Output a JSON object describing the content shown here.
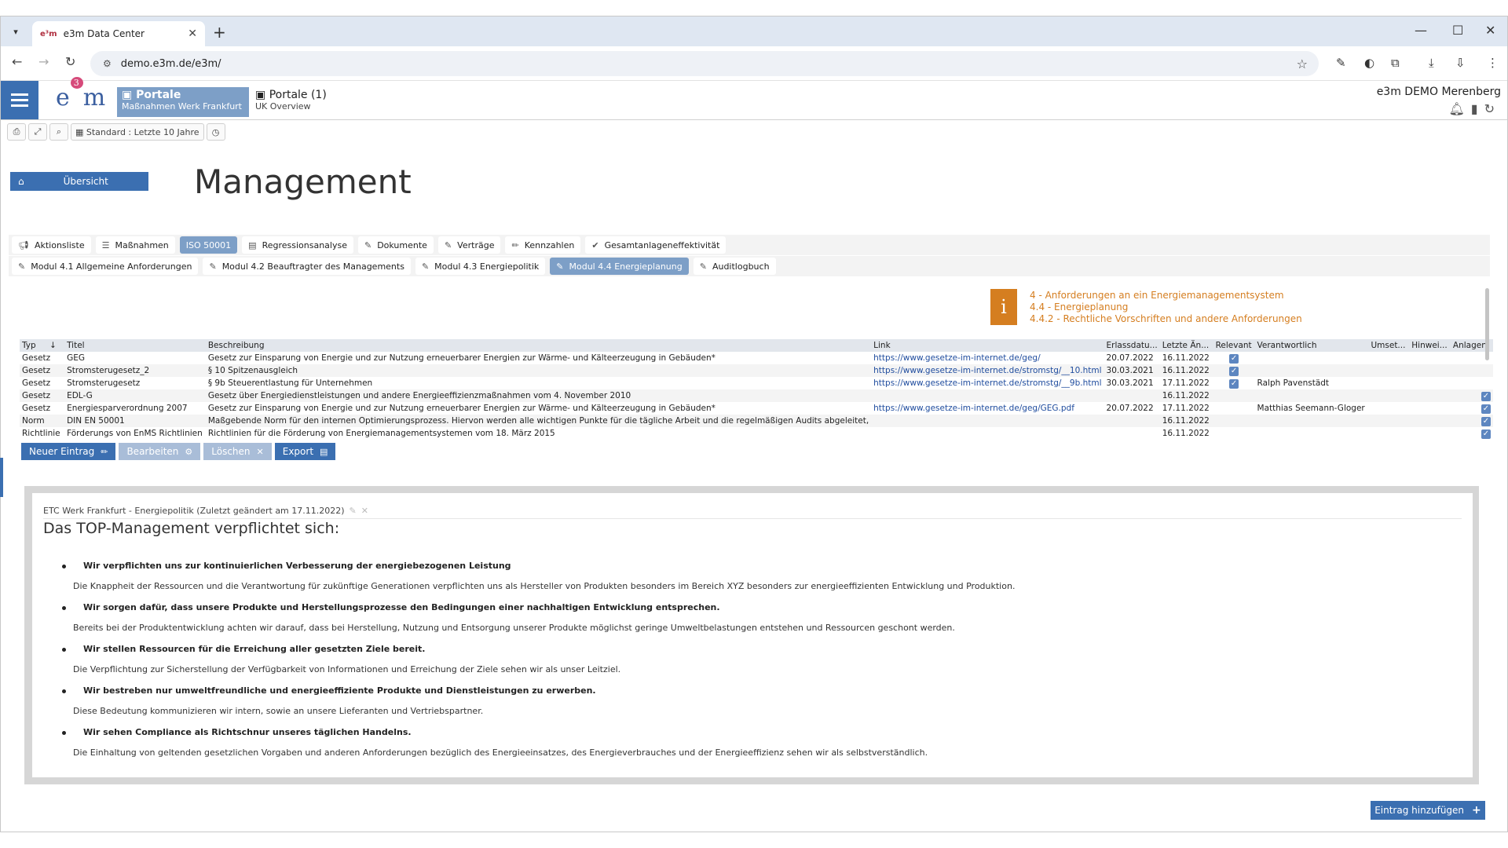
{
  "browser": {
    "tab_title": "e3m Data Center",
    "tab_favicon": "e³m",
    "url": "demo.e3m.de/e3m/"
  },
  "header": {
    "portal_active": {
      "title": "Portale",
      "subtitle": "Maßnahmen Werk Frankfurt"
    },
    "portal_inactive": {
      "title": "Portale (1)",
      "subtitle": "UK Overview"
    },
    "tenant": "e3m DEMO Merenberg",
    "logo": "e3m"
  },
  "subbar": {
    "period_label": "Standard : Letzte 10 Jahre"
  },
  "overview_label": "Übersicht",
  "page_title": "Management",
  "tabs_row1": [
    {
      "label": "Aktionsliste",
      "icon": "megaphone-icon"
    },
    {
      "label": "Maßnahmen",
      "icon": "list-icon"
    },
    {
      "label": "ISO 50001",
      "icon": "",
      "active": true
    },
    {
      "label": "Regressionsanalyse",
      "icon": "chart-icon"
    },
    {
      "label": "Dokumente",
      "icon": "paperclip-icon"
    },
    {
      "label": "Verträge",
      "icon": "paperclip-icon"
    },
    {
      "label": "Kennzahlen",
      "icon": "pencil-icon"
    },
    {
      "label": "Gesamtanlageneffektivität",
      "icon": "check-icon"
    }
  ],
  "tabs_row2": [
    {
      "label": "Modul 4.1 Allgemeine Anforderungen"
    },
    {
      "label": "Modul 4.2 Beauftragter des Managements"
    },
    {
      "label": "Modul 4.3 Energiepolitik"
    },
    {
      "label": "Modul 4.4 Energieplanung",
      "active": true
    },
    {
      "label": "Auditlogbuch"
    }
  ],
  "info": {
    "line1": "4 - Anforderungen an ein Energiemanagementsystem",
    "line2": "4.4 - Energieplanung",
    "line3": "4.4.2 - Rechtliche Vorschriften und andere Anforderungen"
  },
  "table": {
    "headers": [
      "Typ",
      "Titel",
      "Beschreibung",
      "Link",
      "Erlassdatu...",
      "Letzte Än...",
      "Relevant",
      "Verantwortlich",
      "Umset...",
      "Hinwei...",
      "Anlagen"
    ],
    "rows": [
      {
        "typ": "Gesetz",
        "titel": "GEG",
        "beschreibung": "Gesetz zur Einsparung von Energie und zur Nutzung erneuerbarer Energien zur Wärme- und Kälteerzeugung in Gebäuden*",
        "link": "https://www.gesetze-im-internet.de/geg/",
        "erlass": "20.07.2022",
        "letzte": "16.11.2022",
        "relevant": true,
        "verantwortlich": "",
        "anlagen": false
      },
      {
        "typ": "Gesetz",
        "titel": "Stromsterugesetz_2",
        "beschreibung": "§ 10 Spitzenausgleich",
        "link": "https://www.gesetze-im-internet.de/stromstg/__10.html",
        "erlass": "30.03.2021",
        "letzte": "16.11.2022",
        "relevant": true,
        "verantwortlich": "",
        "anlagen": false
      },
      {
        "typ": "Gesetz",
        "titel": "Stromsterugesetz",
        "beschreibung": "§ 9b Steuerentlastung für Unternehmen",
        "link": "https://www.gesetze-im-internet.de/stromstg/__9b.html",
        "erlass": "30.03.2021",
        "letzte": "17.11.2022",
        "relevant": true,
        "verantwortlich": "Ralph Pavenstädt",
        "anlagen": false
      },
      {
        "typ": "Gesetz",
        "titel": "EDL-G",
        "beschreibung": "Gesetz über Energiedienstleistungen und andere Energieeffizienzmaßnahmen vom 4. November 2010",
        "link": "",
        "erlass": "",
        "letzte": "16.11.2022",
        "relevant": false,
        "verantwortlich": "",
        "anlagen": true
      },
      {
        "typ": "Gesetz",
        "titel": "Energiesparverordnung 2007",
        "beschreibung": "Gesetz zur Einsparung von Energie und zur Nutzung erneuerbarer Energien zur Wärme- und Kälteerzeugung in Gebäuden*",
        "link": "https://www.gesetze-im-internet.de/geg/GEG.pdf",
        "erlass": "20.07.2022",
        "letzte": "17.11.2022",
        "relevant": false,
        "verantwortlich": "Matthias Seemann-Gloger",
        "anlagen": true
      },
      {
        "typ": "Norm",
        "titel": "DIN EN 50001",
        "beschreibung": "Maßgebende Norm für den internen Optimierungsprozess. Hiervon werden alle wichtigen Punkte für die tägliche Arbeit und die regelmäßigen Audits abgeleitet,",
        "link": "",
        "erlass": "",
        "letzte": "16.11.2022",
        "relevant": false,
        "verantwortlich": "",
        "anlagen": true
      },
      {
        "typ": "Richtlinie",
        "titel": "Förderungs von EnMS Richtlinien",
        "beschreibung": "Richtlinien für die Förderung von Energiemanagementsystemen vom 18. März 2015",
        "link": "",
        "erlass": "",
        "letzte": "16.11.2022",
        "relevant": false,
        "verantwortlich": "",
        "anlagen": true
      }
    ]
  },
  "actions": {
    "new": "Neuer Eintrag",
    "edit": "Bearbeiten",
    "delete": "Löschen",
    "export": "Export"
  },
  "policy": {
    "meta": "ETC Werk Frankfurt - Energiepolitik (Zuletzt geändert am 17.11.2022)",
    "heading": "Das TOP-Management verpflichtet sich:",
    "items": [
      {
        "title": "Wir verpflichten uns zur kontinuierlichen Verbesserung der energiebezogenen Leistung",
        "desc": "Die Knappheit der Ressourcen und die Verantwortung für zukünftige Generationen verpflichten uns als Hersteller von Produkten besonders im Bereich XYZ besonders zur energieeffizienten Entwicklung und Produktion."
      },
      {
        "title": "Wir sorgen dafür, dass unsere Produkte und Herstellungsprozesse den Bedingungen einer nachhaltigen Entwicklung entsprechen.",
        "desc": "Bereits bei der Produktentwicklung achten wir darauf, dass bei Herstellung, Nutzung und Entsorgung unserer Produkte möglichst geringe Umweltbelastungen entstehen und Ressourcen geschont werden."
      },
      {
        "title": "Wir stellen Ressourcen für die Erreichung aller gesetzten Ziele bereit.",
        "desc": "Die Verpflichtung zur Sicherstellung der Verfügbarkeit von Informationen und Erreichung der Ziele sehen wir als unser Leitziel."
      },
      {
        "title": "Wir bestreben nur umweltfreundliche und energieeffiziente Produkte und Dienstleistungen zu erwerben.",
        "desc": "Diese Bedeutung kommunizieren wir intern, sowie an unsere Lieferanten und Vertriebspartner."
      },
      {
        "title": "Wir sehen Compliance als Richtschnur unseres täglichen Handelns.",
        "desc": "Die Einhaltung von geltenden gesetzlichen Vorgaben und anderen Anforderungen bezüglich des Energieeinsatzes, des Energieverbrauches und der Energieeffizienz sehen wir als selbstverständlich."
      }
    ]
  },
  "add_entry": "Eintrag hinzufügen"
}
